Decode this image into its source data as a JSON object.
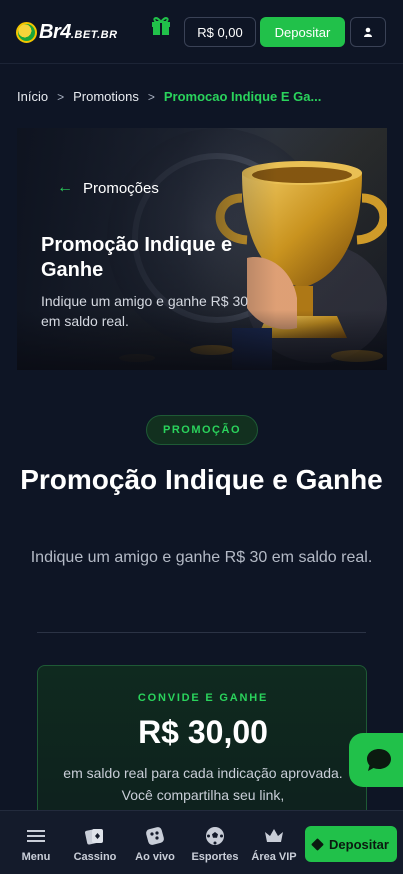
{
  "header": {
    "logo_text": "Br4",
    "logo_suffix": ".BET.BR",
    "balance": "R$ 0,00",
    "deposit_label": "Depositar"
  },
  "breadcrumb": {
    "home": "Início",
    "section": "Promotions",
    "current": "Promocao Indique E Ga..."
  },
  "banner": {
    "back_label": "Promoções",
    "title": "Promoção Indique e Ganhe",
    "description": "Indique um amigo e ganhe R$ 30 em saldo real."
  },
  "main": {
    "badge": "PROMOÇÃO",
    "title": "Promoção Indique e Ganhe",
    "description": "Indique um amigo e ganhe R$ 30 em saldo real."
  },
  "invite_card": {
    "label": "CONVIDE E GANHE",
    "amount": "R$ 30,00",
    "description": "em saldo real para cada indicação aprovada. Você compartilha seu link,"
  },
  "bottom_nav": {
    "items": [
      {
        "label": "Menu",
        "icon": "menu-icon"
      },
      {
        "label": "Cassino",
        "icon": "cards-icon"
      },
      {
        "label": "Ao vivo",
        "icon": "dice-icon"
      },
      {
        "label": "Esportes",
        "icon": "soccer-ball-icon"
      },
      {
        "label": "Área VIP",
        "icon": "crown-icon"
      }
    ],
    "deposit_label": "Depositar"
  },
  "colors": {
    "background": "#0e1525",
    "accent_green": "#21c14a",
    "highlight_green": "#2ad35c"
  }
}
